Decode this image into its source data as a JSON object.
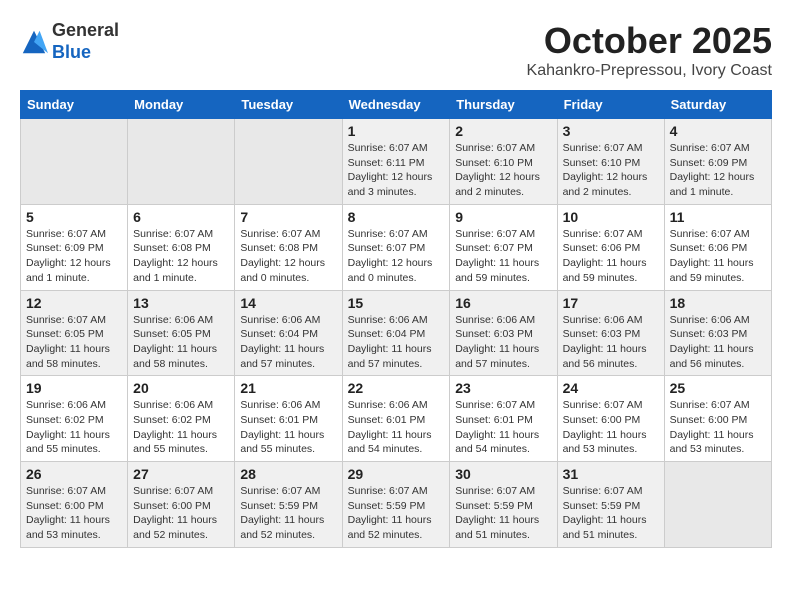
{
  "logo": {
    "general": "General",
    "blue": "Blue"
  },
  "header": {
    "month": "October 2025",
    "location": "Kahankro-Prepressou, Ivory Coast"
  },
  "days_of_week": [
    "Sunday",
    "Monday",
    "Tuesday",
    "Wednesday",
    "Thursday",
    "Friday",
    "Saturday"
  ],
  "weeks": [
    [
      {
        "day": "",
        "info": ""
      },
      {
        "day": "",
        "info": ""
      },
      {
        "day": "",
        "info": ""
      },
      {
        "day": "1",
        "info": "Sunrise: 6:07 AM\nSunset: 6:11 PM\nDaylight: 12 hours and 3 minutes."
      },
      {
        "day": "2",
        "info": "Sunrise: 6:07 AM\nSunset: 6:10 PM\nDaylight: 12 hours and 2 minutes."
      },
      {
        "day": "3",
        "info": "Sunrise: 6:07 AM\nSunset: 6:10 PM\nDaylight: 12 hours and 2 minutes."
      },
      {
        "day": "4",
        "info": "Sunrise: 6:07 AM\nSunset: 6:09 PM\nDaylight: 12 hours and 1 minute."
      }
    ],
    [
      {
        "day": "5",
        "info": "Sunrise: 6:07 AM\nSunset: 6:09 PM\nDaylight: 12 hours and 1 minute."
      },
      {
        "day": "6",
        "info": "Sunrise: 6:07 AM\nSunset: 6:08 PM\nDaylight: 12 hours and 1 minute."
      },
      {
        "day": "7",
        "info": "Sunrise: 6:07 AM\nSunset: 6:08 PM\nDaylight: 12 hours and 0 minutes."
      },
      {
        "day": "8",
        "info": "Sunrise: 6:07 AM\nSunset: 6:07 PM\nDaylight: 12 hours and 0 minutes."
      },
      {
        "day": "9",
        "info": "Sunrise: 6:07 AM\nSunset: 6:07 PM\nDaylight: 11 hours and 59 minutes."
      },
      {
        "day": "10",
        "info": "Sunrise: 6:07 AM\nSunset: 6:06 PM\nDaylight: 11 hours and 59 minutes."
      },
      {
        "day": "11",
        "info": "Sunrise: 6:07 AM\nSunset: 6:06 PM\nDaylight: 11 hours and 59 minutes."
      }
    ],
    [
      {
        "day": "12",
        "info": "Sunrise: 6:07 AM\nSunset: 6:05 PM\nDaylight: 11 hours and 58 minutes."
      },
      {
        "day": "13",
        "info": "Sunrise: 6:06 AM\nSunset: 6:05 PM\nDaylight: 11 hours and 58 minutes."
      },
      {
        "day": "14",
        "info": "Sunrise: 6:06 AM\nSunset: 6:04 PM\nDaylight: 11 hours and 57 minutes."
      },
      {
        "day": "15",
        "info": "Sunrise: 6:06 AM\nSunset: 6:04 PM\nDaylight: 11 hours and 57 minutes."
      },
      {
        "day": "16",
        "info": "Sunrise: 6:06 AM\nSunset: 6:03 PM\nDaylight: 11 hours and 57 minutes."
      },
      {
        "day": "17",
        "info": "Sunrise: 6:06 AM\nSunset: 6:03 PM\nDaylight: 11 hours and 56 minutes."
      },
      {
        "day": "18",
        "info": "Sunrise: 6:06 AM\nSunset: 6:03 PM\nDaylight: 11 hours and 56 minutes."
      }
    ],
    [
      {
        "day": "19",
        "info": "Sunrise: 6:06 AM\nSunset: 6:02 PM\nDaylight: 11 hours and 55 minutes."
      },
      {
        "day": "20",
        "info": "Sunrise: 6:06 AM\nSunset: 6:02 PM\nDaylight: 11 hours and 55 minutes."
      },
      {
        "day": "21",
        "info": "Sunrise: 6:06 AM\nSunset: 6:01 PM\nDaylight: 11 hours and 55 minutes."
      },
      {
        "day": "22",
        "info": "Sunrise: 6:06 AM\nSunset: 6:01 PM\nDaylight: 11 hours and 54 minutes."
      },
      {
        "day": "23",
        "info": "Sunrise: 6:07 AM\nSunset: 6:01 PM\nDaylight: 11 hours and 54 minutes."
      },
      {
        "day": "24",
        "info": "Sunrise: 6:07 AM\nSunset: 6:00 PM\nDaylight: 11 hours and 53 minutes."
      },
      {
        "day": "25",
        "info": "Sunrise: 6:07 AM\nSunset: 6:00 PM\nDaylight: 11 hours and 53 minutes."
      }
    ],
    [
      {
        "day": "26",
        "info": "Sunrise: 6:07 AM\nSunset: 6:00 PM\nDaylight: 11 hours and 53 minutes."
      },
      {
        "day": "27",
        "info": "Sunrise: 6:07 AM\nSunset: 6:00 PM\nDaylight: 11 hours and 52 minutes."
      },
      {
        "day": "28",
        "info": "Sunrise: 6:07 AM\nSunset: 5:59 PM\nDaylight: 11 hours and 52 minutes."
      },
      {
        "day": "29",
        "info": "Sunrise: 6:07 AM\nSunset: 5:59 PM\nDaylight: 11 hours and 52 minutes."
      },
      {
        "day": "30",
        "info": "Sunrise: 6:07 AM\nSunset: 5:59 PM\nDaylight: 11 hours and 51 minutes."
      },
      {
        "day": "31",
        "info": "Sunrise: 6:07 AM\nSunset: 5:59 PM\nDaylight: 11 hours and 51 minutes."
      },
      {
        "day": "",
        "info": ""
      }
    ]
  ]
}
